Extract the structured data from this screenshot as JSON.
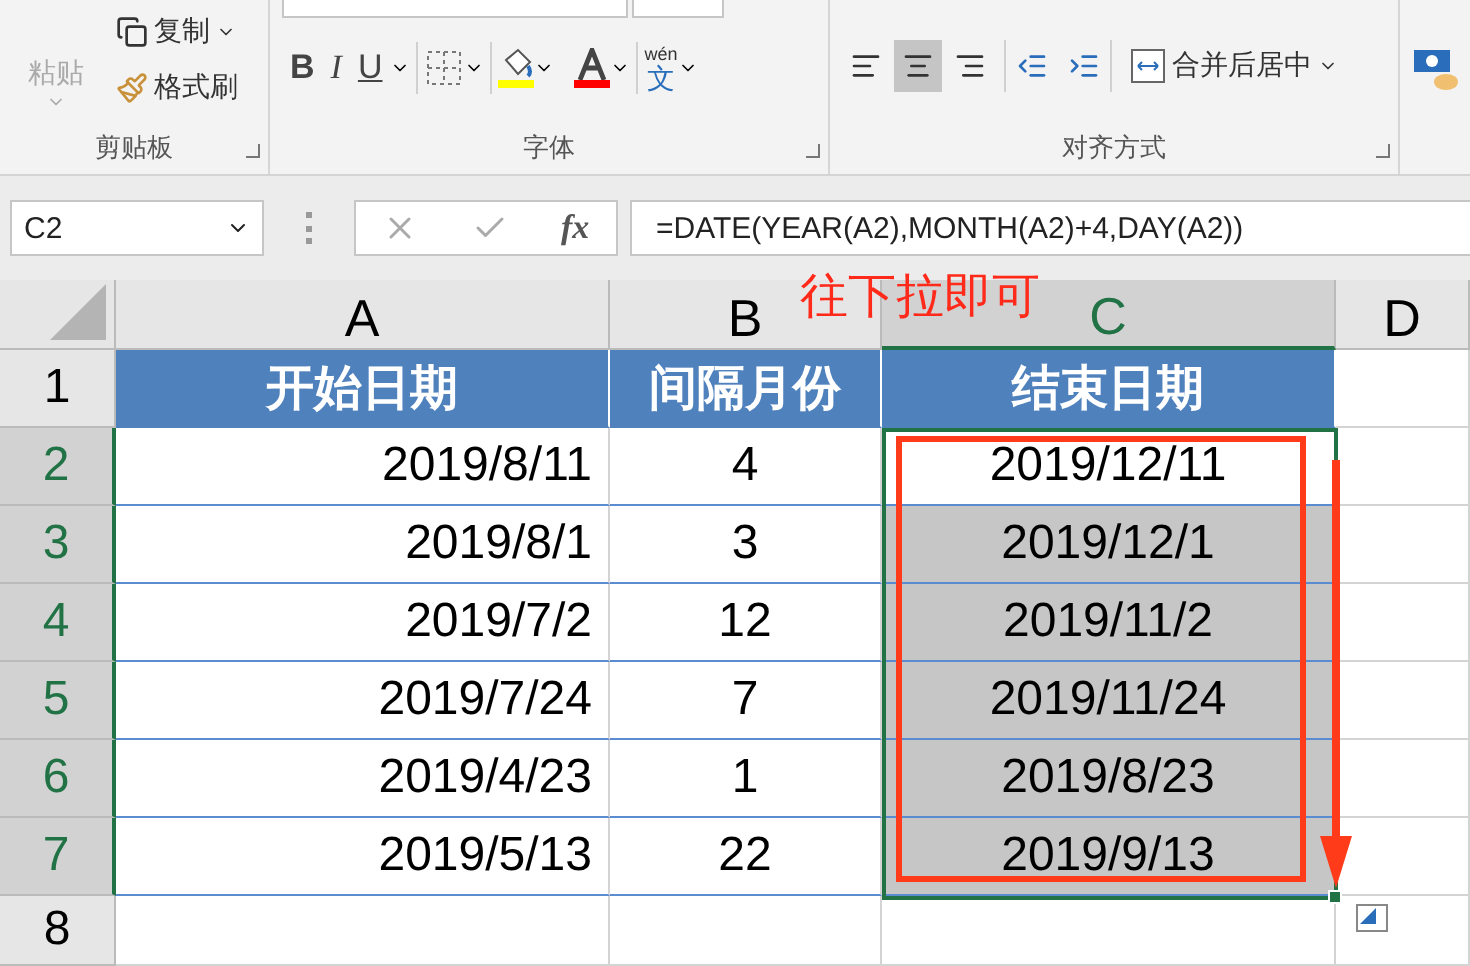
{
  "clipboard": {
    "label": "剪贴板",
    "paste": "粘贴",
    "copy": "复制",
    "format_painter": "格式刷"
  },
  "font": {
    "label": "字体",
    "bold": "B",
    "italic": "I",
    "underline": "U",
    "phonetic": [
      "wén",
      "文"
    ]
  },
  "alignment": {
    "label": "对齐方式",
    "align_buttons": [
      {
        "kind": "left",
        "selected": false
      },
      {
        "kind": "center",
        "selected": true
      },
      {
        "kind": "right",
        "selected": false
      }
    ],
    "merge": "合并后居中"
  },
  "formula_bar": {
    "name_box": "C2",
    "fx": "fx",
    "formula": "=DATE(YEAR(A2),MONTH(A2)+4,DAY(A2))"
  },
  "columns": [
    {
      "label": "A",
      "selected": false
    },
    {
      "label": "B",
      "selected": false
    },
    {
      "label": "C",
      "selected": true
    },
    {
      "label": "D",
      "selected": false
    }
  ],
  "annotation": "往下拉即可",
  "rows": [
    {
      "number": "1",
      "kind": "header",
      "selected": false,
      "highlighted": false,
      "cells": [
        "开始日期",
        "间隔月份",
        "结束日期"
      ]
    },
    {
      "number": "2",
      "kind": "data",
      "selected": true,
      "highlighted": false,
      "cells": [
        "2019/8/11",
        "4",
        "2019/12/11"
      ]
    },
    {
      "number": "3",
      "kind": "data",
      "selected": true,
      "highlighted": true,
      "cells": [
        "2019/8/1",
        "3",
        "2019/12/1"
      ]
    },
    {
      "number": "4",
      "kind": "data",
      "selected": true,
      "highlighted": true,
      "cells": [
        "2019/7/2",
        "12",
        "2019/11/2"
      ]
    },
    {
      "number": "5",
      "kind": "data",
      "selected": true,
      "highlighted": true,
      "cells": [
        "2019/7/24",
        "7",
        "2019/11/24"
      ]
    },
    {
      "number": "6",
      "kind": "data",
      "selected": true,
      "highlighted": true,
      "cells": [
        "2019/4/23",
        "1",
        "2019/8/23"
      ]
    },
    {
      "number": "7",
      "kind": "data",
      "selected": true,
      "highlighted": true,
      "cells": [
        "2019/5/13",
        "22",
        "2019/9/13"
      ]
    },
    {
      "number": "8",
      "kind": "empty",
      "selected": false,
      "highlighted": false
    }
  ]
}
